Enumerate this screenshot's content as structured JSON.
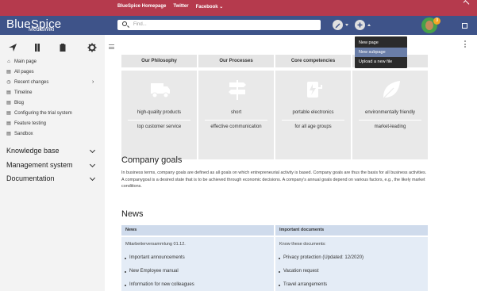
{
  "topbar": {
    "links": [
      "BlueSpice Homepage",
      "Twitter",
      "Facebook ⌄"
    ]
  },
  "header": {
    "logo": "BlueSpice",
    "logo_sub": "MediaWiki",
    "search_placeholder": "Find...",
    "notification_count": "3"
  },
  "sidebar": {
    "items": [
      {
        "label": "Main page",
        "icon": "home-icon"
      },
      {
        "label": "All pages",
        "icon": "doc-icon"
      },
      {
        "label": "Recent changes",
        "icon": "clock-icon"
      },
      {
        "label": "Timeline",
        "icon": "doc-icon"
      },
      {
        "label": "Blog",
        "icon": "doc-icon"
      },
      {
        "label": "Configuring the trial system",
        "icon": "doc-icon"
      },
      {
        "label": "Feature testing",
        "icon": "doc-icon"
      },
      {
        "label": "Sandbox",
        "icon": "doc-icon"
      }
    ],
    "recent_arrow": "›",
    "sections": [
      "Knowledge base",
      "Management system",
      "Documentation"
    ]
  },
  "dropdown": {
    "items": [
      "New page",
      "New subpage",
      "Upload a new file"
    ]
  },
  "grid": {
    "headers": [
      "Our Philosophy",
      "Our Processes",
      "Core competencies",
      ""
    ],
    "cells": [
      {
        "line1": "high-quality products",
        "line2": "top customer service"
      },
      {
        "line1": "short",
        "line2": "effective communication"
      },
      {
        "line1": "portable electronics",
        "line2": "for all age groups"
      },
      {
        "line1": "environmentally friendly",
        "line2": "market-leading"
      }
    ]
  },
  "goals": {
    "title": "Company goals",
    "text": "In business terms, company goals are defined as all goals on which entrepreneurial activity is based. Company goals are thus the basis for all business activities. A companygoal is a desired state that is to be achieved through economic decisions. A company's annual goals depend on various factors, e.g., the likely market conditions."
  },
  "news": {
    "title": "News",
    "col1_header": "News",
    "col2_header": "Important documents",
    "col1_intro": "Mitarbeiterversammlung 01.12.",
    "col1_items": [
      "Important announcements",
      "New Employee manual",
      "Information for new colleagues"
    ],
    "col2_intro": "Know these documents:",
    "col2_items": [
      "Privacy protection (Updated: 12/2020)",
      "Vacation request",
      "Travel arrangements"
    ]
  },
  "colors": {
    "topbar": "#b53a4d",
    "header": "#3e5389",
    "dropdown_active": "#6a7ea8",
    "table_header": "#cfdbec",
    "table_cell": "#e4ecf6"
  }
}
